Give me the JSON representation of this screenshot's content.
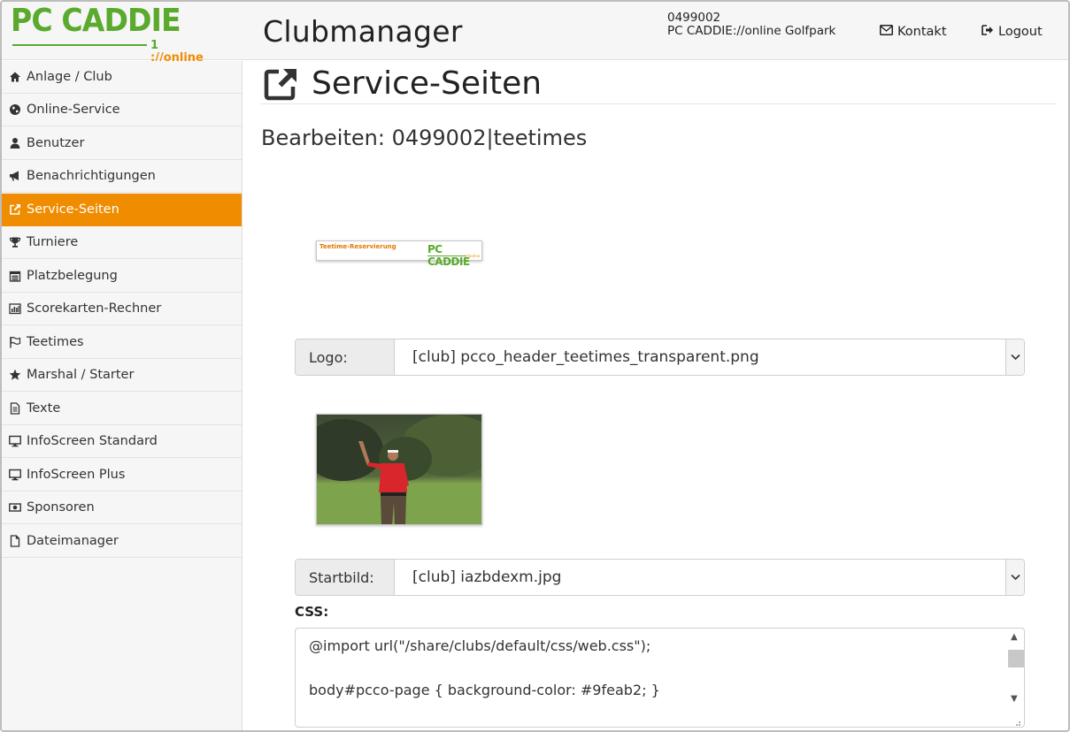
{
  "header": {
    "logo_main": "PC CADDIE",
    "logo_sub": "://online",
    "app_title": "Clubmanager",
    "club_number": "0499002",
    "club_name": "PC CADDIE://online Golfpark",
    "contact_label": "Kontakt",
    "logout_label": "Logout"
  },
  "sidebar": {
    "items": [
      {
        "label": "Anlage / Club",
        "icon": "home-icon"
      },
      {
        "label": "Online-Service",
        "icon": "globe-icon"
      },
      {
        "label": "Benutzer",
        "icon": "user-icon"
      },
      {
        "label": "Benachrichtigungen",
        "icon": "bullhorn-icon"
      },
      {
        "label": "Service-Seiten",
        "icon": "external-link-icon",
        "active": true
      },
      {
        "label": "Turniere",
        "icon": "trophy-icon"
      },
      {
        "label": "Platzbelegung",
        "icon": "calendar-icon"
      },
      {
        "label": "Scorekarten-Rechner",
        "icon": "bar-chart-icon"
      },
      {
        "label": "Teetimes",
        "icon": "flag-icon"
      },
      {
        "label": "Marshal / Starter",
        "icon": "star-icon"
      },
      {
        "label": "Texte",
        "icon": "file-text-icon"
      },
      {
        "label": "InfoScreen Standard",
        "icon": "desktop-icon"
      },
      {
        "label": "InfoScreen Plus",
        "icon": "desktop-icon"
      },
      {
        "label": "Sponsoren",
        "icon": "money-icon"
      },
      {
        "label": "Dateimanager",
        "icon": "file-icon"
      }
    ]
  },
  "main": {
    "page_title": "Service-Seiten",
    "subtitle": "Bearbeiten: 0499002|teetimes",
    "logo_preview": {
      "left_text": "Teetime-Reservierung",
      "right_text": "PC CADDIE",
      "sub_text": "://online"
    },
    "logo_field": {
      "label": "Logo:",
      "value": "[club] pcco_header_teetimes_transparent.png"
    },
    "startbild_field": {
      "label": "Startbild:",
      "value": "[club] iazbdexm.jpg"
    },
    "css_label": "CSS:",
    "css_lines": [
      "@import url(\"/share/clubs/default/css/web.css\");",
      "body#pcco-page { background-color: #9feab2; }"
    ]
  },
  "colors": {
    "accent": "#f08c00",
    "brand_green": "#5aaa2e",
    "sidebar_bg": "#f6f6f6"
  }
}
